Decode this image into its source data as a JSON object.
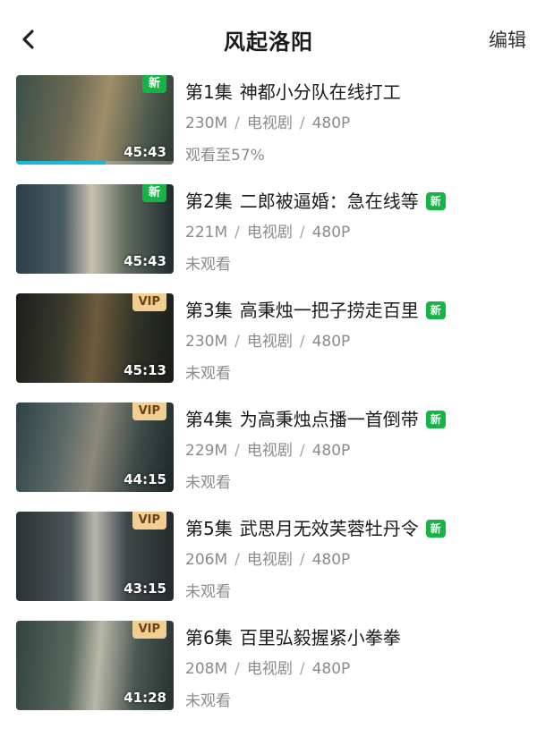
{
  "header": {
    "title": "风起洛阳",
    "edit_label": "编辑"
  },
  "episodes": [
    {
      "ep": "第1集",
      "name": "神都小分队在线打工",
      "size": "230M",
      "category": "电视剧",
      "quality": "480P",
      "status": "观看至57%",
      "progress": 0.57,
      "duration": "45:43",
      "badge": "新",
      "badge_type": "new",
      "title_new_tag": ""
    },
    {
      "ep": "第2集",
      "name": "二郎被逼婚：急在线等",
      "size": "221M",
      "category": "电视剧",
      "quality": "480P",
      "status": "未观看",
      "progress": 0,
      "duration": "45:43",
      "badge": "新",
      "badge_type": "new",
      "title_new_tag": "新"
    },
    {
      "ep": "第3集",
      "name": "高秉烛一把子捞走百里",
      "size": "230M",
      "category": "电视剧",
      "quality": "480P",
      "status": "未观看",
      "progress": 0,
      "duration": "45:13",
      "badge": "VIP",
      "badge_type": "vip",
      "title_new_tag": "新"
    },
    {
      "ep": "第4集",
      "name": "为高秉烛点播一首倒带",
      "size": "229M",
      "category": "电视剧",
      "quality": "480P",
      "status": "未观看",
      "progress": 0,
      "duration": "44:15",
      "badge": "VIP",
      "badge_type": "vip",
      "title_new_tag": "新"
    },
    {
      "ep": "第5集",
      "name": "武思月无效芙蓉牡丹令",
      "size": "206M",
      "category": "电视剧",
      "quality": "480P",
      "status": "未观看",
      "progress": 0,
      "duration": "43:15",
      "badge": "VIP",
      "badge_type": "vip",
      "title_new_tag": "新"
    },
    {
      "ep": "第6集",
      "name": "百里弘毅握紧小拳拳",
      "size": "208M",
      "category": "电视剧",
      "quality": "480P",
      "status": "未观看",
      "progress": 0,
      "duration": "41:28",
      "badge": "VIP",
      "badge_type": "vip",
      "title_new_tag": ""
    }
  ]
}
